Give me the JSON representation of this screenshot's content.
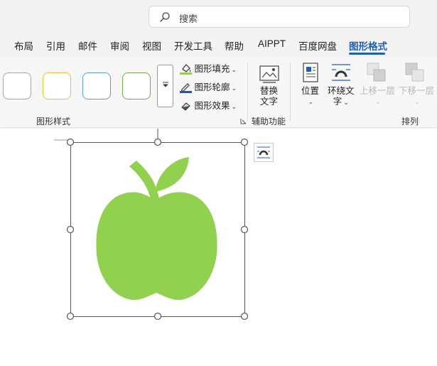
{
  "search": {
    "placeholder": "搜索",
    "icon": "search-icon"
  },
  "tabs": [
    {
      "label": "布局"
    },
    {
      "label": "引用"
    },
    {
      "label": "邮件"
    },
    {
      "label": "审阅"
    },
    {
      "label": "视图"
    },
    {
      "label": "开发工具"
    },
    {
      "label": "帮助"
    },
    {
      "label": "AIPPT"
    },
    {
      "label": "百度网盘"
    },
    {
      "label": "图形格式",
      "active": true
    }
  ],
  "ribbon": {
    "shape_styles": {
      "label": "图形样式",
      "swatch_colors": [
        "#a6a6a6",
        "#f0c12b",
        "#5b9bd5",
        "#70ad47"
      ],
      "fill_label": "图形填充",
      "outline_label": "图形轮廓",
      "effects_label": "图形效果"
    },
    "accessibility": {
      "label": "辅助功能",
      "alt_text_line1": "替换",
      "alt_text_line2": "文字"
    },
    "arrange": {
      "label": "排列",
      "position_label": "位置",
      "wrap_text_line1": "环绕文",
      "wrap_text_line2": "字",
      "bring_forward_label": "上移一层",
      "send_backward_label": "下移一层"
    }
  },
  "colors": {
    "accent": "#1f5fb4",
    "apple": "#92d050",
    "fill_bar": "#92d050",
    "outline_bar": "#2f5597"
  }
}
